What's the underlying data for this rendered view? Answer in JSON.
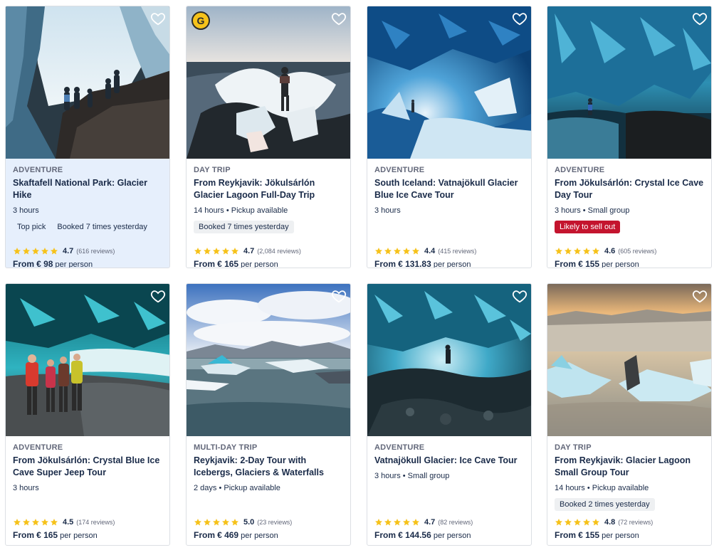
{
  "cards": [
    {
      "category": "ADVENTURE",
      "title": "Skaftafell National Park: Glacier Hike",
      "meta": "3 hours",
      "tags": [
        "Top pick",
        "Booked 7 times yesterday"
      ],
      "rating": "4.7",
      "reviews": "(616 reviews)",
      "price_prefix": "From",
      "price": "€ 98",
      "price_suffix": "per person",
      "favorite_icon": "heart-outline-icon",
      "highlighted": true
    },
    {
      "category": "DAY TRIP",
      "title": "From Reykjavik: Jökulsárlón Glacier Lagoon Full-Day Trip",
      "meta": "14 hours • Pickup available",
      "tags": [
        "Booked 7 times yesterday"
      ],
      "rating": "4.7",
      "reviews": "(2,084 reviews)",
      "price_prefix": "From",
      "price": "€ 165",
      "price_suffix": "per person",
      "favorite_icon": "heart-outline-icon",
      "badge": "G"
    },
    {
      "category": "ADVENTURE",
      "title": "South Iceland: Vatnajökull Glacier Blue Ice Cave Tour",
      "meta": "3 hours",
      "tags": [],
      "rating": "4.4",
      "reviews": "(415 reviews)",
      "price_prefix": "From",
      "price": "€ 131.83",
      "price_suffix": "per person",
      "favorite_icon": "heart-outline-icon"
    },
    {
      "category": "ADVENTURE",
      "title": "From Jökulsárlón: Crystal Ice Cave Day Tour",
      "meta": "3 hours • Small group",
      "tags": [
        "Likely to sell out"
      ],
      "rating": "4.6",
      "reviews": "(605 reviews)",
      "price_prefix": "From",
      "price": "€ 155",
      "price_suffix": "per person",
      "favorite_icon": "heart-outline-icon"
    },
    {
      "category": "ADVENTURE",
      "title": "From Jökulsárlón: Crystal Blue Ice Cave Super Jeep Tour",
      "meta": "3 hours",
      "tags": [],
      "rating": "4.5",
      "reviews": "(174 reviews)",
      "price_prefix": "From",
      "price": "€ 165",
      "price_suffix": "per person",
      "favorite_icon": "heart-outline-icon"
    },
    {
      "category": "MULTI-DAY TRIP",
      "title": "Reykjavik: 2-Day Tour with Icebergs, Glaciers & Waterfalls",
      "meta": "2 days • Pickup available",
      "tags": [],
      "rating": "5.0",
      "reviews": "(23 reviews)",
      "price_prefix": "From",
      "price": "€ 469",
      "price_suffix": "per person",
      "favorite_icon": "heart-outline-icon"
    },
    {
      "category": "ADVENTURE",
      "title": "Vatnajökull Glacier: Ice Cave Tour",
      "meta": "3 hours • Small group",
      "tags": [],
      "rating": "4.7",
      "reviews": "(82 reviews)",
      "price_prefix": "From",
      "price": "€ 144.56",
      "price_suffix": "per person",
      "favorite_icon": "heart-outline-icon"
    },
    {
      "category": "DAY TRIP",
      "title": "From Reykjavik: Glacier Lagoon Small Group Tour",
      "meta": "14 hours • Pickup available",
      "tags": [
        "Booked 2 times yesterday"
      ],
      "rating": "4.8",
      "reviews": "(72 reviews)",
      "price_prefix": "From",
      "price": "€ 155",
      "price_suffix": "per person",
      "favorite_icon": "heart-outline-icon"
    }
  ],
  "colors": {
    "text": "#1a2b49",
    "muted": "#63687a",
    "star": "#f6c21a",
    "sellout": "#c4142e",
    "highlight": "#e6effc"
  }
}
